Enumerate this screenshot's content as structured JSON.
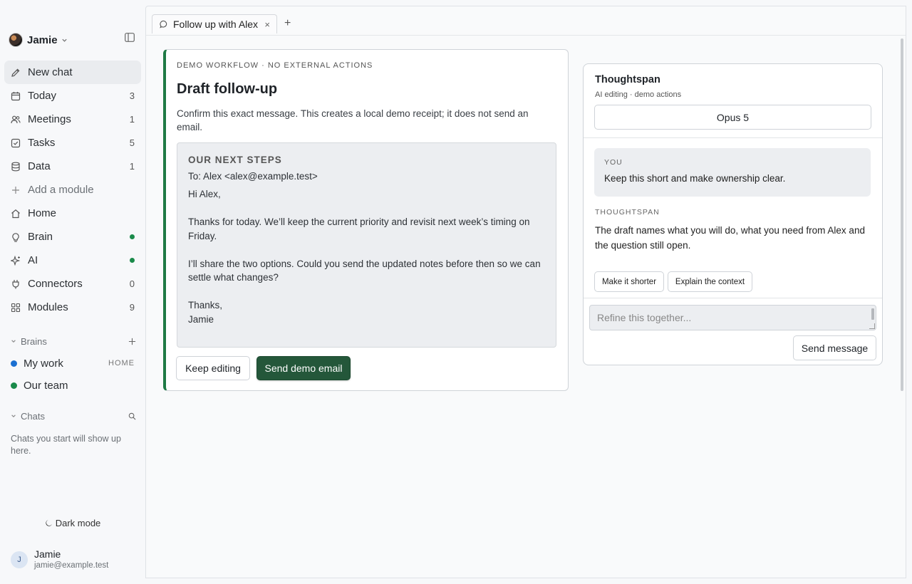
{
  "sidebar": {
    "workspace": {
      "name": "Jamie"
    },
    "nav": [
      {
        "label": "New chat",
        "icon": "pencil-icon",
        "count": ""
      },
      {
        "label": "Today",
        "icon": "calendar-icon",
        "count": "3"
      },
      {
        "label": "Meetings",
        "icon": "users-icon",
        "count": "1"
      },
      {
        "label": "Tasks",
        "icon": "checkbox-icon",
        "count": "5"
      },
      {
        "label": "Data",
        "icon": "database-icon",
        "count": "1"
      },
      {
        "label": "Add a module",
        "icon": "plus-icon",
        "count": ""
      },
      {
        "label": "Home",
        "icon": "home-icon",
        "count": ""
      },
      {
        "label": "Brain",
        "icon": "lightbulb-icon",
        "status": "green-dot"
      },
      {
        "label": "AI",
        "icon": "sparkle-icon",
        "status": "green-dot"
      },
      {
        "label": "Connectors",
        "icon": "plug-icon",
        "count": "0"
      },
      {
        "label": "Modules",
        "icon": "grid-icon",
        "count": "9"
      }
    ],
    "brains_heading": "Brains",
    "brains": [
      {
        "label": "My work",
        "tag": "HOME",
        "color": "#1a6fd1"
      },
      {
        "label": "Our team",
        "tag": "",
        "color": "#1a8a4a"
      }
    ],
    "chats_heading": "Chats",
    "chats_empty": "Chats you start will show up here.",
    "dark_mode": "Dark mode",
    "user": {
      "initial": "J",
      "name": "Jamie",
      "email": "jamie@example.test"
    }
  },
  "tabs": [
    {
      "label": "Follow up with Alex",
      "close": "×"
    }
  ],
  "new_tab": "+",
  "draft": {
    "eyebrow": "DEMO WORKFLOW · NO EXTERNAL ACTIONS",
    "title": "Draft follow-up",
    "description": "Confirm this exact message. This creates a local demo receipt; it does not send an email.",
    "email": {
      "subject": "OUR NEXT STEPS",
      "to": "To: Alex <alex@example.test>",
      "greeting": "Hi Alex,",
      "para1": "Thanks for today. We’ll keep the current priority and revisit next week’s timing on Friday.",
      "para2": "I’ll share the two options. Could you send the updated notes before then so we can settle what changes?",
      "signoff": "Thanks,",
      "signature": "Jamie"
    },
    "keep_editing": "Keep editing",
    "send_demo": "Send demo email",
    "accent_color": "#1f7a45"
  },
  "assistant": {
    "title": "Thoughtspan",
    "subtitle": "AI editing · demo actions",
    "model": "Opus 5",
    "user_label": "YOU",
    "user_message": "Keep this short and make ownership clear.",
    "bot_label": "THOUGHTSPAN",
    "bot_message": "The draft names what you will do, what you need from Alex and the question still open.",
    "suggestions": [
      "Make it shorter",
      "Explain the context"
    ],
    "composer_placeholder": "Refine this together...",
    "send_label": "Send message"
  }
}
